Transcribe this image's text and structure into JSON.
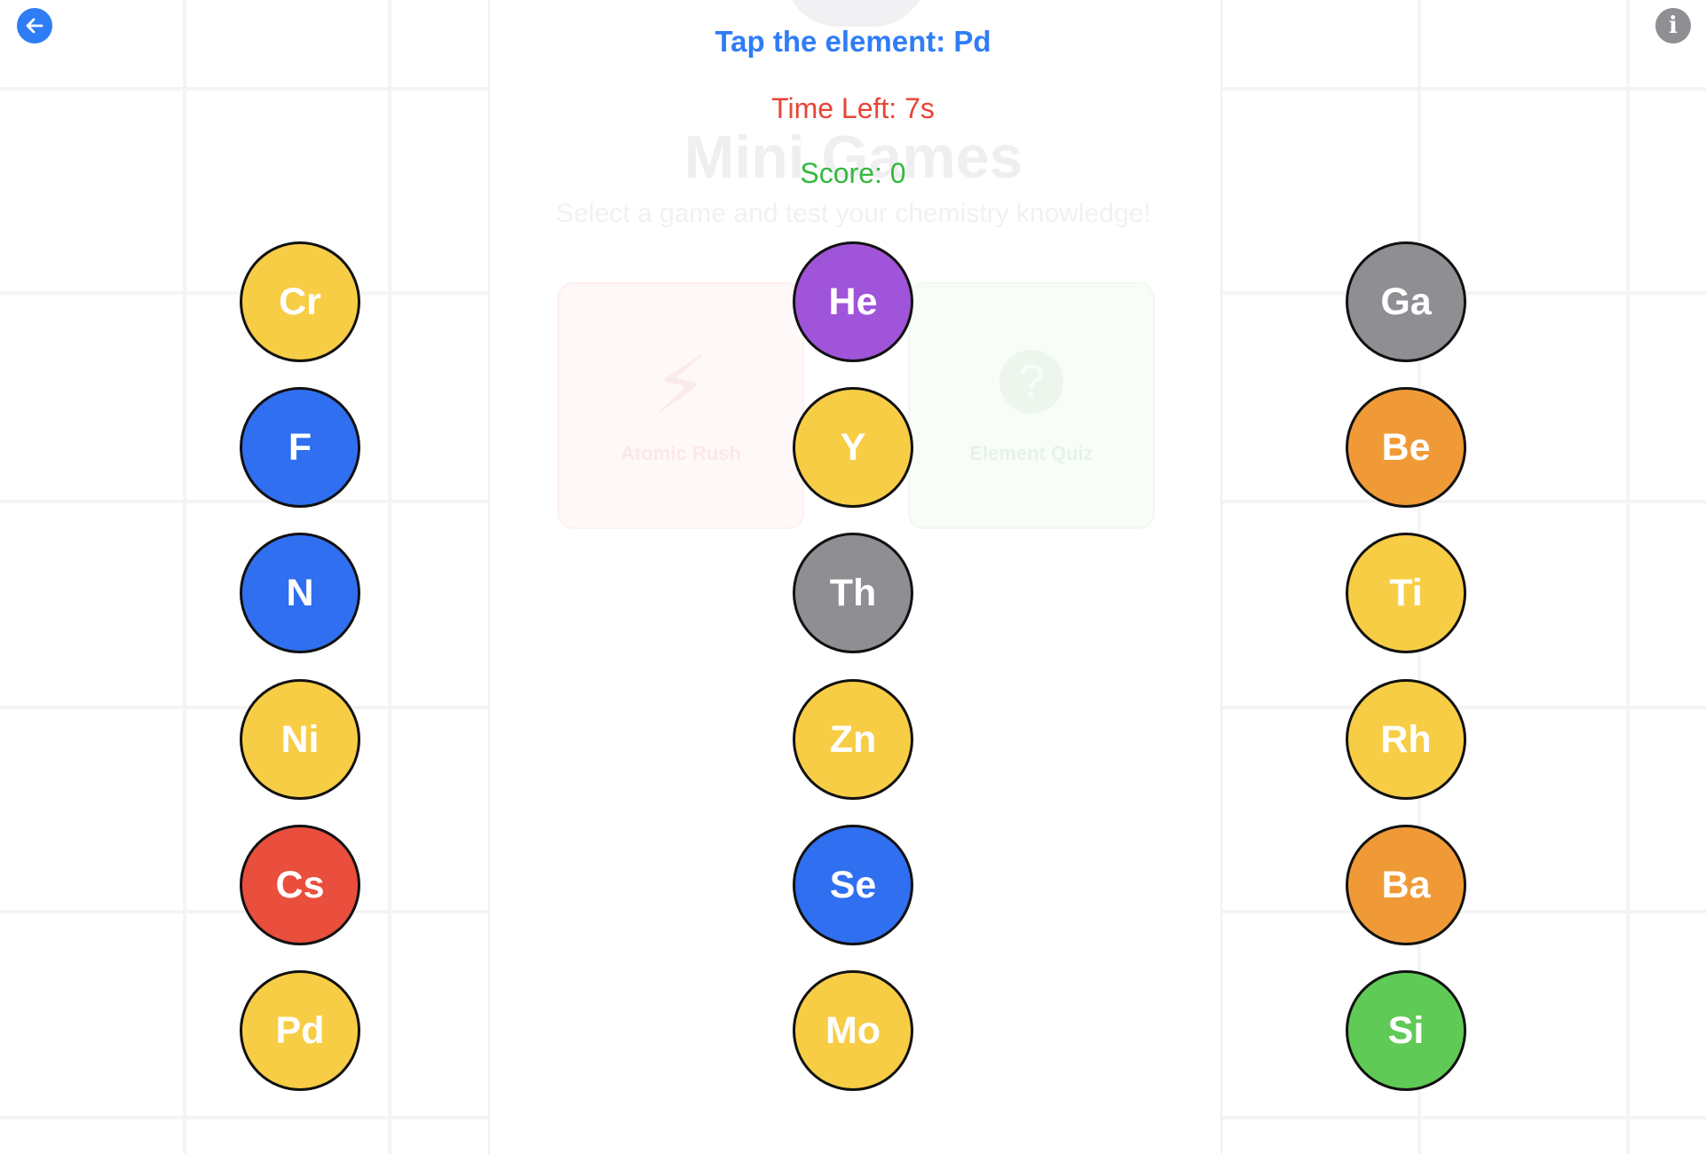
{
  "game": {
    "prompt": "Tap the element: Pd",
    "time_left": "Time Left: 7s",
    "score": "Score: 0"
  },
  "background_screen": {
    "title": "Mini Games",
    "subtitle": "Select a game and test your chemistry knowledge!",
    "cards": [
      {
        "label": "Atomic Rush",
        "icon": "lightning-icon"
      },
      {
        "label": "Element Quiz",
        "icon": "question-mark-icon"
      }
    ]
  },
  "controls": {
    "back_icon": "arrow-left-icon",
    "info_icon": "info-icon",
    "info_glyph": "i"
  },
  "colors": {
    "prompt": "#2f7df6",
    "timer": "#ea4335",
    "score": "#36b840",
    "yellow": "#f7cd45",
    "blue": "#2f6ff0",
    "purple": "#a054d9",
    "gray": "#8e8e93",
    "orange": "#f09a37",
    "red": "#ea4e3d",
    "green": "#5fca55"
  },
  "columns": [
    {
      "elements": [
        {
          "symbol": "Cr",
          "color": "yellow"
        },
        {
          "symbol": "F",
          "color": "blue"
        },
        {
          "symbol": "N",
          "color": "blue"
        },
        {
          "symbol": "Ni",
          "color": "yellow"
        },
        {
          "symbol": "Cs",
          "color": "red"
        },
        {
          "symbol": "Pd",
          "color": "yellow"
        }
      ]
    },
    {
      "elements": [
        {
          "symbol": "He",
          "color": "purple"
        },
        {
          "symbol": "Y",
          "color": "yellow"
        },
        {
          "symbol": "Th",
          "color": "gray"
        },
        {
          "symbol": "Zn",
          "color": "yellow"
        },
        {
          "symbol": "Se",
          "color": "blue"
        },
        {
          "symbol": "Mo",
          "color": "yellow"
        }
      ]
    },
    {
      "elements": [
        {
          "symbol": "Ga",
          "color": "gray"
        },
        {
          "symbol": "Be",
          "color": "orange"
        },
        {
          "symbol": "Ti",
          "color": "yellow"
        },
        {
          "symbol": "Rh",
          "color": "yellow"
        },
        {
          "symbol": "Ba",
          "color": "orange"
        },
        {
          "symbol": "Si",
          "color": "green"
        }
      ]
    }
  ]
}
